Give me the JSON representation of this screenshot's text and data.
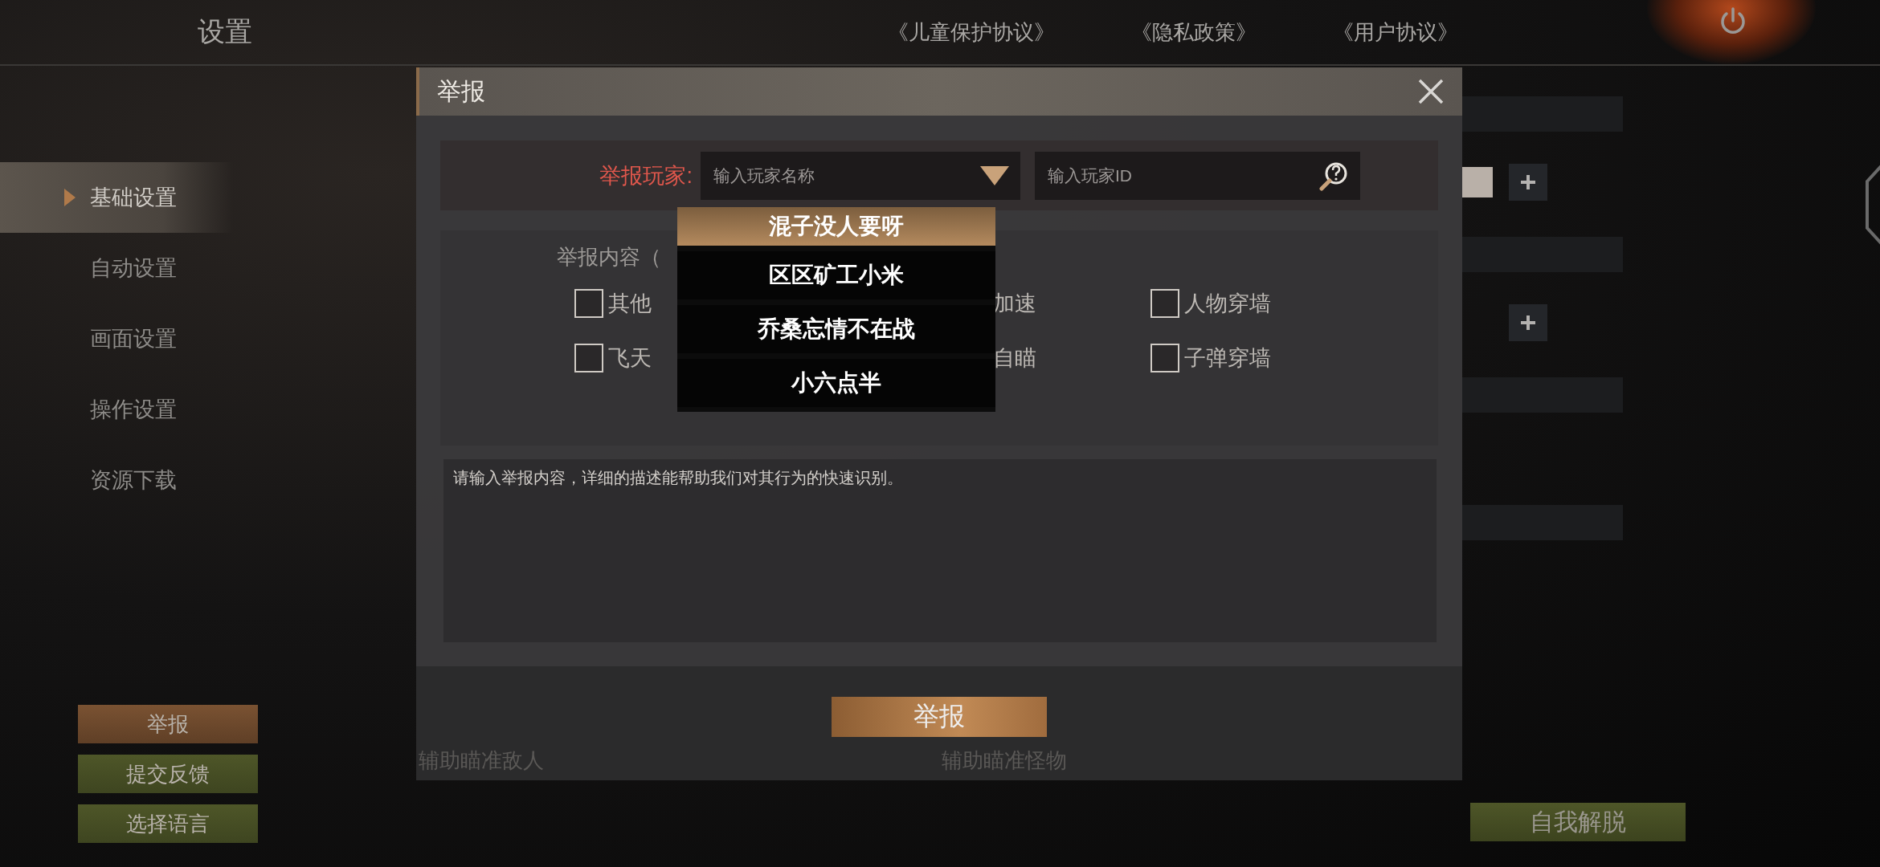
{
  "header": {
    "title": "设置",
    "links": [
      "《儿童保护协议》",
      "《隐私政策》",
      "《用户协议》"
    ]
  },
  "sidebar": {
    "items": [
      {
        "label": "基础设置",
        "selected": true
      },
      {
        "label": "自动设置",
        "selected": false
      },
      {
        "label": "画面设置",
        "selected": false
      },
      {
        "label": "操作设置",
        "selected": false
      },
      {
        "label": "资源下载",
        "selected": false
      }
    ]
  },
  "side_buttons": [
    {
      "label": "举报",
      "kind": "report"
    },
    {
      "label": "提交反馈",
      "kind": "feedback"
    },
    {
      "label": "选择语言",
      "kind": "feedback"
    }
  ],
  "unstuck_button": "自我解脱",
  "dialog": {
    "title": "举报",
    "player_label": "举报玩家:",
    "name_placeholder": "输入玩家名称",
    "id_placeholder": "输入玩家ID",
    "dropdown": [
      {
        "name": "混子没人要呀",
        "selected": true
      },
      {
        "name": "区区矿工小米",
        "selected": false
      },
      {
        "name": "乔桑忘情不在战",
        "selected": false
      },
      {
        "name": "小六点半",
        "selected": false
      }
    ],
    "content_label": "举报内容（",
    "options": [
      {
        "label": "其他",
        "kind": "checkbox",
        "checked": false
      },
      {
        "label": "加速",
        "kind": "label"
      },
      {
        "label": "人物穿墙",
        "kind": "checkbox",
        "checked": false
      },
      {
        "label": "飞天",
        "kind": "checkbox",
        "checked": false
      },
      {
        "label": "自瞄",
        "kind": "label"
      },
      {
        "label": "子弹穿墙",
        "kind": "checkbox",
        "checked": false
      }
    ],
    "description_placeholder": "请输入举报内容，详细的描述能帮助我们对其行为的快速识别。",
    "submit": "举报",
    "background_labels": [
      "辅助瞄准敌人",
      "辅助瞄准怪物"
    ]
  }
}
